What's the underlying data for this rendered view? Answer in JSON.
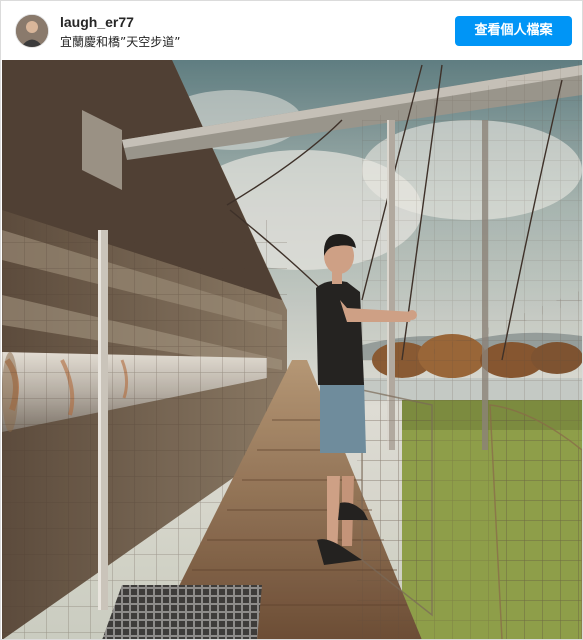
{
  "post": {
    "username": "laugh_er77",
    "location": "宜蘭慶和橋”天空步道”",
    "profile_button": "查看個人檔案"
  },
  "colors": {
    "button": "#0095f6",
    "sky": "#c9d0cf",
    "rust": "#7a5a3c",
    "grass": "#8fa24a"
  }
}
